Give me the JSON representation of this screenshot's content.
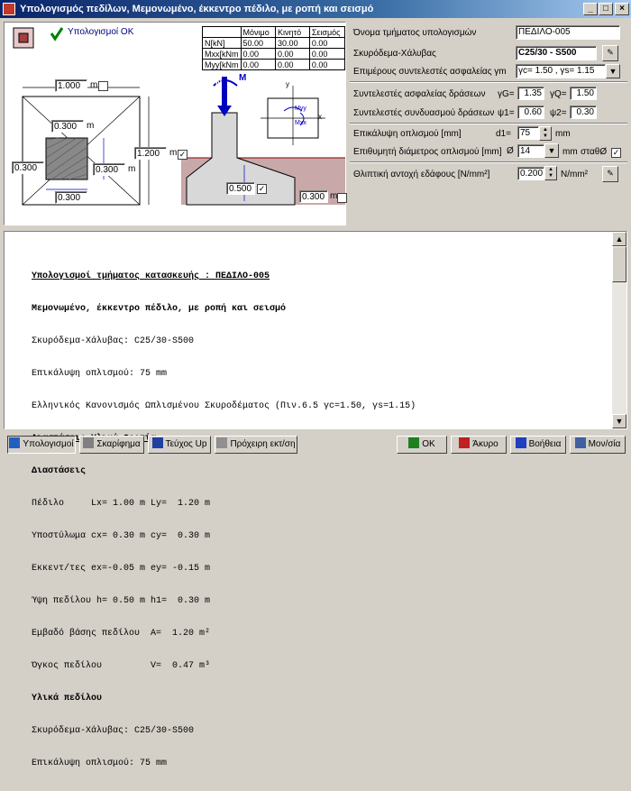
{
  "window": {
    "title": "Υπολογισμός πεδίλων, Μεμονωμένο, έκκεντρο πέδιλο, με ροπή και σεισμό",
    "min": "_",
    "max": "□",
    "close": "×"
  },
  "calc_ok": "Υπολογισμοί ΟΚ",
  "loads": {
    "headers": [
      "",
      "Μόνιμο",
      "Κινητό",
      "Σεισμός"
    ],
    "rows": [
      [
        "N[kN]",
        "50.00",
        "30.00",
        "0.00"
      ],
      [
        "Mxx[kNm",
        "0.00",
        "0.00",
        "0.00"
      ],
      [
        "Myy[kNm",
        "0.00",
        "0.00",
        "0.00"
      ]
    ]
  },
  "dims": {
    "lx": "1.000",
    "m": "m",
    "cx": "0.300",
    "cy": "0.300",
    "ex": "0.300",
    "ey": "0.300",
    "ly": "1.200",
    "h": "0.500",
    "h1": "0.300"
  },
  "drawing": {
    "N": "N",
    "M": "M",
    "y": "y",
    "x": "x",
    "myy": "Myy",
    "mxx": "Mxx"
  },
  "props": {
    "name_label": "Όνομα τμήματος υπολογισμών",
    "name_value": "ΠΕΔΙΛΟ-005",
    "material_label": "Σκυρόδεμα-Χάλυβας",
    "material_value": "C25/30 - S500",
    "safety_label": "Επιμέρους συντελεστές ασφαλείας γm",
    "safety_value": "γc= 1.50 , γs= 1.15",
    "load_safety_label": "Συντελεστές ασφαλείας δράσεων",
    "gG": "γG=",
    "gG_val": "1.35",
    "gQ": "γQ=",
    "gQ_val": "1.50",
    "comb_label": "Συντελεστές συνδυασμού δράσεων",
    "psi1": "ψ1=",
    "psi1_val": "0.60",
    "psi2": "ψ2=",
    "psi2_val": "0.30",
    "cover_label": "Επικάλυψη οπλισμού [mm]",
    "d1": "d1=",
    "d1_val": "75",
    "mm": "mm",
    "diam_label": "Επιθυμητή διάμετρος οπλισμού [mm]",
    "phi": "Ø",
    "phi_val": "14",
    "stath": "σταθØ",
    "soil_label": "Θλιπτική αντοχή εδάφους [N/mm²]",
    "soil_val": "0.200",
    "soil_unit": "N/mm²"
  },
  "report": [
    "Υπολογισμοί τμήματος κατασκευής : ΠΕΔΙΛΟ-005",
    "Μεμονωμένο, έκκεντρο πέδιλο, με ροπή και σεισμό",
    "Σκυρόδεμα-Χάλυβας: C25/30-S500",
    "Επικάλυψη οπλισμού: 75 mm",
    "Ελληνικός Κανονισμός Ωπλισμένου Σκυροδέματος (Πιν.6.5 γc=1.50, γs=1.15)",
    "Διαστάσεις-Υλικά-Φορτία",
    "Διαστάσεις",
    "Πέδιλο     Lx= 1.00 m Ly=  1.20 m",
    "Υποστύλωμα cx= 0.30 m cy=  0.30 m",
    "Εκκεντ/τες ex=-0.05 m ey= -0.15 m",
    "Ύψη πεδίλου h= 0.50 m h1=  0.30 m",
    "Εμβαδό βάσης πεδίλου  A=  1.20 m²",
    "Όγκος πεδίλου         V=  0.47 m³",
    "Υλικά πεδίλου",
    "Σκυρόδεμα-Χάλυβας: C25/30-S500",
    "Επικάλυψη οπλισμού: 75 mm"
  ],
  "buttons": {
    "calc": "Υπολογισμοί",
    "sketch": "Σκαρίφημα",
    "teuxos": "Τεύχος Up",
    "print": "Πρόχειρη εκτ/ση",
    "ok": "OK",
    "cancel": "Άκυρο",
    "help": "Βοήθεια",
    "units": "Μον/σία"
  }
}
